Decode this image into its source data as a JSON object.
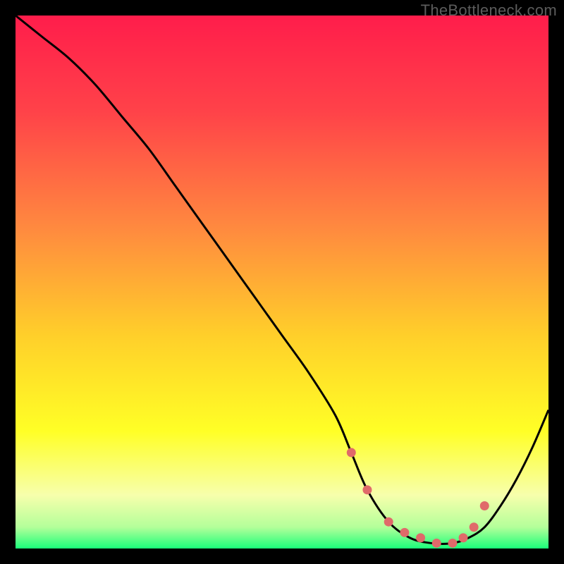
{
  "watermark": "TheBottleneck.com",
  "chart_data": {
    "type": "line",
    "title": "",
    "xlabel": "",
    "ylabel": "",
    "xlim": [
      0,
      100
    ],
    "ylim": [
      0,
      100
    ],
    "gradient_stops": [
      {
        "offset": 0,
        "color": "#ff1d4b"
      },
      {
        "offset": 18,
        "color": "#ff4249"
      },
      {
        "offset": 40,
        "color": "#ff8a3f"
      },
      {
        "offset": 60,
        "color": "#ffcf2a"
      },
      {
        "offset": 78,
        "color": "#ffff26"
      },
      {
        "offset": 90,
        "color": "#f7ffac"
      },
      {
        "offset": 96,
        "color": "#b4ff9a"
      },
      {
        "offset": 100,
        "color": "#1aff7a"
      }
    ],
    "series": [
      {
        "name": "bottleneck-curve",
        "x": [
          0,
          5,
          10,
          15,
          20,
          25,
          30,
          35,
          40,
          45,
          50,
          55,
          60,
          63,
          66,
          70,
          74,
          78,
          82,
          85,
          88,
          91,
          94,
          97,
          100
        ],
        "y": [
          100,
          96,
          92,
          87,
          81,
          75,
          68,
          61,
          54,
          47,
          40,
          33,
          25,
          18,
          11,
          5,
          2,
          1,
          1,
          2,
          4,
          8,
          13,
          19,
          26
        ]
      }
    ],
    "markers": {
      "name": "highlight-dots",
      "color": "#e06a6a",
      "x": [
        63,
        66,
        70,
        73,
        76,
        79,
        82,
        84,
        86,
        88
      ],
      "y": [
        18,
        11,
        5,
        3,
        2,
        1,
        1,
        2,
        4,
        8
      ]
    }
  }
}
